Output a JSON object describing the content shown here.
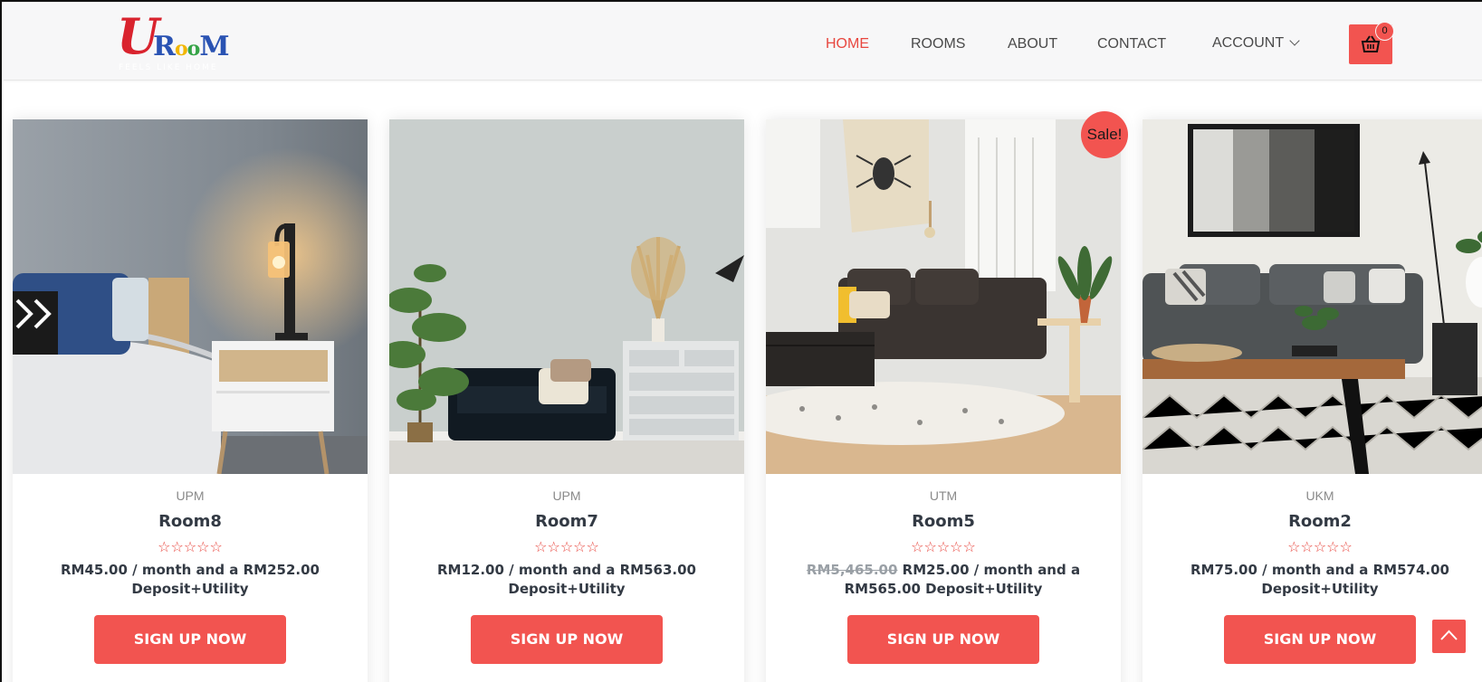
{
  "brand": {
    "logo_u": "U",
    "logo_r": "R",
    "logo_o1": "o",
    "logo_o2": "o",
    "logo_m": "M",
    "tagline": "FEELS LIKE HOME"
  },
  "nav": {
    "items": [
      {
        "label": "HOME",
        "active": true
      },
      {
        "label": "ROOMS",
        "active": false
      },
      {
        "label": "ABOUT",
        "active": false
      },
      {
        "label": "CONTACT",
        "active": false
      },
      {
        "label": "ACCOUNT",
        "active": false,
        "has_dropdown": true
      }
    ],
    "cart_count": "0",
    "cart_icon": "basket-icon"
  },
  "products": [
    {
      "category": "UPM",
      "title": "Room8",
      "rating_stars": "☆☆☆☆☆",
      "old_price": "",
      "price_text": "RM45.00 / month and a RM252.00 Deposit+Utility",
      "button": "SIGN UP NOW",
      "sale": false
    },
    {
      "category": "UPM",
      "title": "Room7",
      "rating_stars": "☆☆☆☆☆",
      "old_price": "",
      "price_text": "RM12.00 / month and a RM563.00 Deposit+Utility",
      "button": "SIGN UP NOW",
      "sale": false
    },
    {
      "category": "UTM",
      "title": "Room5",
      "rating_stars": "☆☆☆☆☆",
      "old_price": "RM5,465.00",
      "price_text": "RM25.00 / month and a RM565.00 Deposit+Utility",
      "button": "SIGN UP NOW",
      "sale": true
    },
    {
      "category": "UKM",
      "title": "Room2",
      "rating_stars": "☆☆☆☆☆",
      "old_price": "",
      "price_text": "RM75.00 / month and a RM574.00 Deposit+Utility",
      "button": "SIGN UP NOW",
      "sale": false
    }
  ],
  "sale_badge": "Sale!",
  "colors": {
    "accent": "#f25450",
    "active_nav": "#e8473f",
    "text_dark": "#333a44"
  },
  "scroll_top_icon": "chevron-up-icon"
}
